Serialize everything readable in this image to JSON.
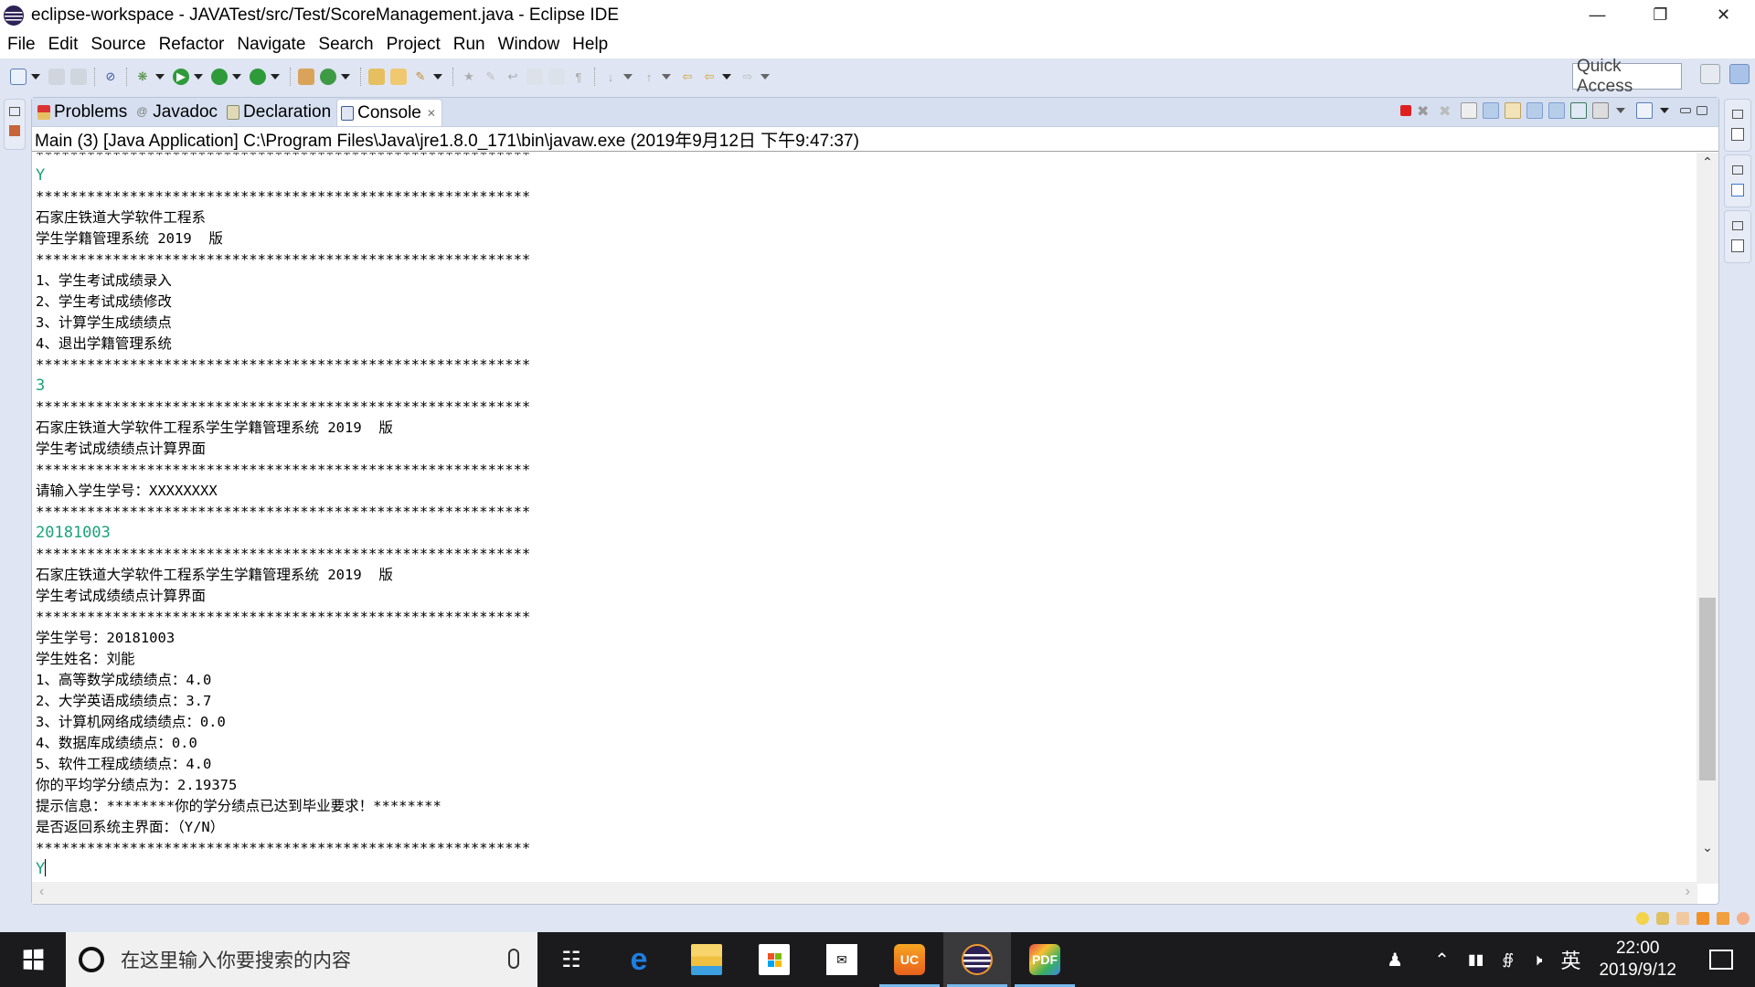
{
  "window": {
    "title": "eclipse-workspace - JAVATest/src/Test/ScoreManagement.java - Eclipse IDE",
    "controls": [
      "minimize",
      "restore",
      "close"
    ]
  },
  "menu": [
    "File",
    "Edit",
    "Source",
    "Refactor",
    "Navigate",
    "Search",
    "Project",
    "Run",
    "Window",
    "Help"
  ],
  "toolbar": {
    "quick_access_placeholder": "Quick Access",
    "icons": [
      "new-icon",
      "save-icon",
      "save-all-icon",
      "skip-breakpoints-icon",
      "debug-icon",
      "run-icon",
      "coverage-icon",
      "external-tools-icon",
      "new-java-package-icon",
      "new-java-class-icon",
      "open-type-icon",
      "open-task-icon",
      "search-icon",
      "toggle-mark-occurrences-icon",
      "word-wrap-icon",
      "block-selection-icon",
      "show-whitespace-icon",
      "next-annotation-icon",
      "previous-annotation-icon",
      "last-edit-location-icon",
      "back-icon",
      "forward-icon"
    ]
  },
  "tabs": [
    {
      "label": "Problems",
      "icon": "problems-icon",
      "active": false
    },
    {
      "label": "Javadoc",
      "icon": "javadoc-icon",
      "active": false
    },
    {
      "label": "Declaration",
      "icon": "declaration-icon",
      "active": false
    },
    {
      "label": "Console",
      "icon": "console-icon",
      "active": true,
      "closable": true
    }
  ],
  "console": {
    "header": "Main (3) [Java Application] C:\\Program Files\\Java\\jre1.8.0_171\\bin\\javaw.exe (2019年9月12日 下午9:47:37)",
    "lines": [
      {
        "text": "**********************************************************",
        "type": "output"
      },
      {
        "text": "Y",
        "type": "input"
      },
      {
        "text": "**********************************************************",
        "type": "output"
      },
      {
        "text": "石家庄铁道大学软件工程系",
        "type": "output"
      },
      {
        "text": "学生学籍管理系统 2019  版",
        "type": "output"
      },
      {
        "text": "**********************************************************",
        "type": "output"
      },
      {
        "text": "1、学生考试成绩录入",
        "type": "output"
      },
      {
        "text": "2、学生考试成绩修改",
        "type": "output"
      },
      {
        "text": "3、计算学生成绩绩点",
        "type": "output"
      },
      {
        "text": "4、退出学籍管理系统",
        "type": "output"
      },
      {
        "text": "**********************************************************",
        "type": "output"
      },
      {
        "text": "3",
        "type": "input"
      },
      {
        "text": "**********************************************************",
        "type": "output"
      },
      {
        "text": "石家庄铁道大学软件工程系学生学籍管理系统 2019  版",
        "type": "output"
      },
      {
        "text": "学生考试成绩绩点计算界面",
        "type": "output"
      },
      {
        "text": "**********************************************************",
        "type": "output"
      },
      {
        "text": "请输入学生学号：XXXXXXXX",
        "type": "output"
      },
      {
        "text": "**********************************************************",
        "type": "output"
      },
      {
        "text": "20181003",
        "type": "input"
      },
      {
        "text": "**********************************************************",
        "type": "output"
      },
      {
        "text": "石家庄铁道大学软件工程系学生学籍管理系统 2019  版",
        "type": "output"
      },
      {
        "text": "学生考试成绩绩点计算界面",
        "type": "output"
      },
      {
        "text": "**********************************************************",
        "type": "output"
      },
      {
        "text": "学生学号：20181003",
        "type": "output"
      },
      {
        "text": "学生姓名：刘能",
        "type": "output"
      },
      {
        "text": "1、高等数学成绩绩点：4.0",
        "type": "output"
      },
      {
        "text": "2、大学英语成绩绩点：3.7",
        "type": "output"
      },
      {
        "text": "3、计算机网络成绩绩点：0.0",
        "type": "output"
      },
      {
        "text": "4、数据库成绩绩点：0.0",
        "type": "output"
      },
      {
        "text": "5、软件工程成绩绩点：4.0",
        "type": "output"
      },
      {
        "text": "你的平均学分绩点为：2.19375",
        "type": "output"
      },
      {
        "text": "提示信息：********你的学分绩点已达到毕业要求！********",
        "type": "output"
      },
      {
        "text": "是否返回系统主界面：（Y/N）",
        "type": "output"
      },
      {
        "text": "**********************************************************",
        "type": "output"
      },
      {
        "text": "Y",
        "type": "input",
        "caret": true
      }
    ],
    "input_color": "#1aa27a",
    "vertical_scroll_position": 0.88
  },
  "taskbar": {
    "search_placeholder": "在这里输入你要搜索的内容",
    "apps": [
      {
        "name": "task-view",
        "running": false
      },
      {
        "name": "edge",
        "running": false
      },
      {
        "name": "file-explorer",
        "running": false
      },
      {
        "name": "microsoft-store",
        "running": false
      },
      {
        "name": "mail",
        "running": false
      },
      {
        "name": "uc-browser",
        "running": true
      },
      {
        "name": "eclipse",
        "running": true,
        "active": true
      },
      {
        "name": "pdf-reader",
        "running": true
      }
    ],
    "tray": {
      "ime": "英",
      "time": "22:00",
      "date": "2019/9/12"
    }
  }
}
